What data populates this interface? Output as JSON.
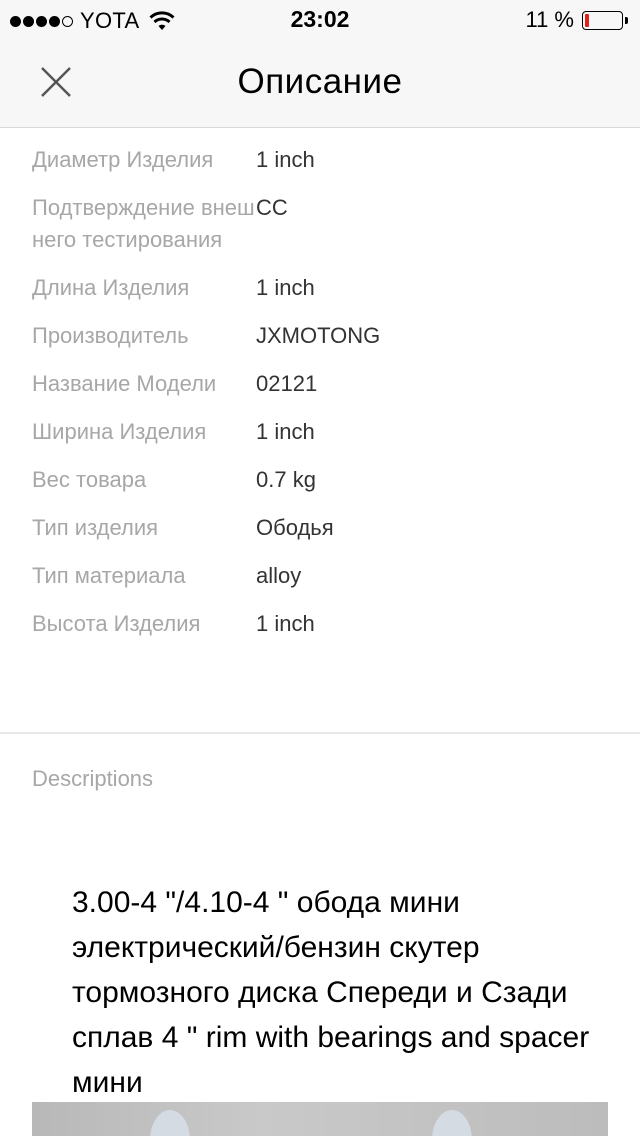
{
  "status_bar": {
    "carrier": "YOTA",
    "time": "23:02",
    "battery_percent": "11 %",
    "battery_level": 0.11
  },
  "nav": {
    "title": "Описание"
  },
  "specs": [
    {
      "label": "Диаметр Изделия",
      "value": "1 inch"
    },
    {
      "label": "Подтверждение внешнего тестирования",
      "value": "CC"
    },
    {
      "label": "Длина Изделия",
      "value": "1 inch"
    },
    {
      "label": "Производитель",
      "value": "JXMOTONG"
    },
    {
      "label": "Название Модели",
      "value": "02121"
    },
    {
      "label": "Ширина Изделия",
      "value": "1 inch"
    },
    {
      "label": "Вес товара",
      "value": "0.7 kg"
    },
    {
      "label": "Тип изделия",
      "value": "Ободья"
    },
    {
      "label": "Тип материала",
      "value": "alloy"
    },
    {
      "label": "Высота Изделия",
      "value": "1 inch"
    }
  ],
  "description": {
    "heading": "Descriptions",
    "text": "3.00-4 \"/4.10-4 \" обода мини электрический/бензин скутер тормозного диска Спереди и Сзади сплав 4 \" rim with bearings and spacer мини"
  }
}
